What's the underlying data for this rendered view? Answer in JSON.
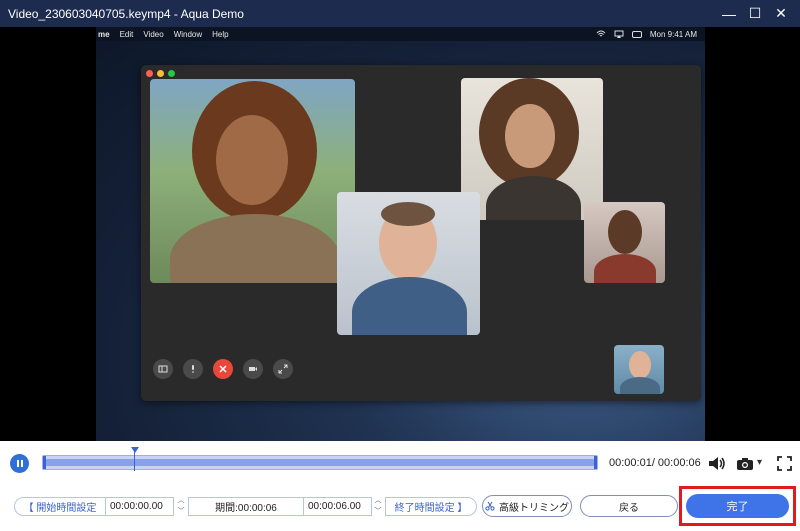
{
  "window": {
    "title": "Video_230603040705.keymp4  -  Aqua Demo",
    "minimize": "—",
    "maximize": "☐",
    "close": "✕"
  },
  "mac_menubar": {
    "items": [
      "me",
      "Edit",
      "Video",
      "Window",
      "Help"
    ],
    "clock": "Mon 9:41 AM"
  },
  "player": {
    "timecode": "00:00:01/ 00:00:06"
  },
  "trim": {
    "start_button": "【 開始時間設定",
    "start_value": "00:00:00.00",
    "duration_value": "期間:00:00:06",
    "end_value": "00:00:06.00",
    "end_button": "終了時間設定 】",
    "advanced_button": "高級トリミング",
    "back_button": "戻る",
    "done_button": "完了",
    "stepper_up": "︿",
    "stepper_down": "﹀"
  },
  "colors": {
    "titlebar": "#1d2b4e",
    "accent": "#3e74e8",
    "highlight": "#e01b1b"
  }
}
